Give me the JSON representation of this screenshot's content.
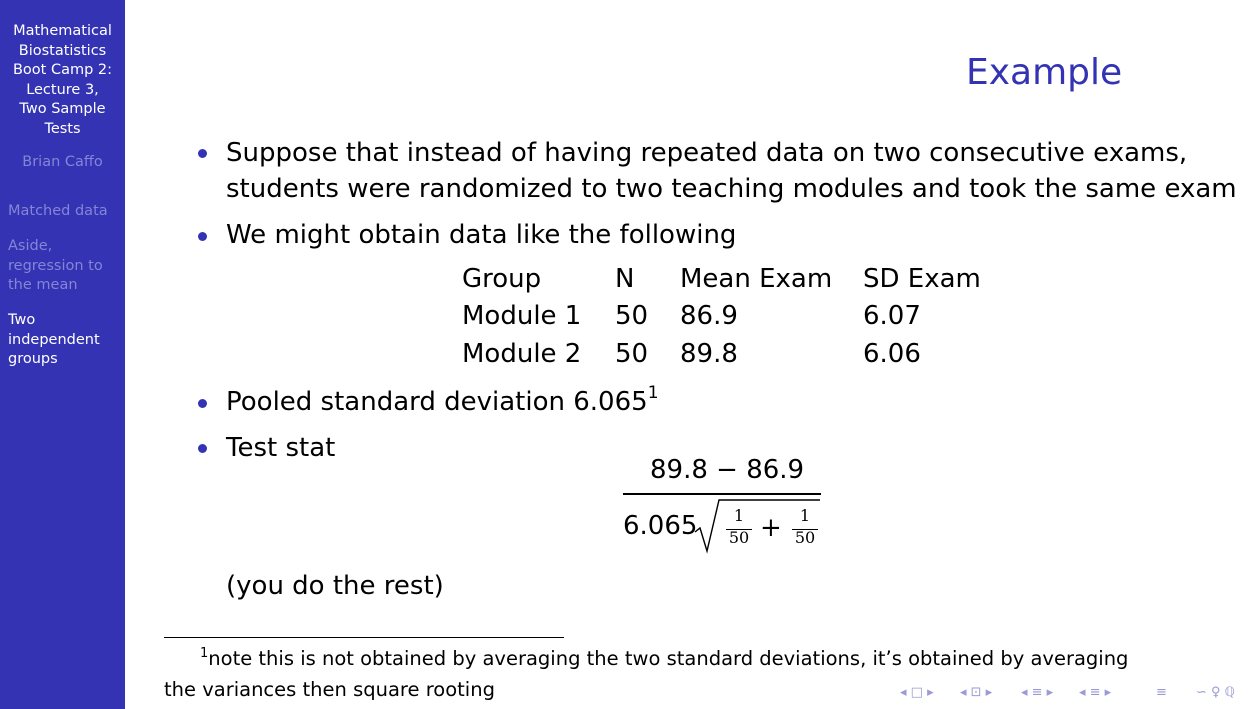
{
  "sidebar": {
    "title_lines": [
      "Mathematical",
      "Biostatistics",
      "Boot Camp 2:",
      "Lecture 3,",
      "Two Sample",
      "Tests"
    ],
    "author": "Brian Caffo",
    "sections": [
      {
        "lines": [
          "Matched data"
        ],
        "active": false
      },
      {
        "lines": [
          "Aside,",
          "regression to",
          "the mean"
        ],
        "active": false
      },
      {
        "lines": [
          "Two",
          "independent",
          "groups"
        ],
        "active": true
      }
    ]
  },
  "frame": {
    "title": "Example",
    "bullets": [
      {
        "lines": [
          "Suppose that instead of having repeated data on two consecutive exams,",
          "students were randomized to two teaching modules and took the same exam"
        ]
      },
      {
        "lines": [
          "We might obtain data like the following"
        ]
      },
      {
        "text": "Pooled standard deviation 6.065",
        "footnote_mark": "1"
      },
      {
        "text": "Test stat"
      }
    ],
    "table": {
      "headers": [
        "Group",
        "N",
        "Mean Exam",
        "SD Exam"
      ],
      "rows": [
        [
          "Module 1",
          "50",
          "86.9",
          "6.07"
        ],
        [
          "Module 2",
          "50",
          "89.8",
          "6.06"
        ]
      ]
    },
    "formula": {
      "numerator": "89.8 − 86.9",
      "denominator_coef": "6.065",
      "frac_num": "1",
      "frac_den": "50",
      "plus": "+"
    },
    "after_formula": "(you do the rest)"
  },
  "footnote": {
    "mark": "1",
    "line1": "note this is not obtained by averaging the two standard deviations, it’s obtained by averaging",
    "line2": "the variances then square rooting"
  },
  "nav_controls": [
    "◂ □ ▸",
    "◂ ⊡ ▸",
    "◂ ≡ ▸",
    "◂ ≡ ▸",
    "≡",
    "∽ ♀ ℚ"
  ],
  "colors": {
    "sidebar_bg": "#3333b3",
    "title": "#3333b3",
    "bullet": "#3333b3",
    "sidebar_dim": "#8585d8"
  }
}
